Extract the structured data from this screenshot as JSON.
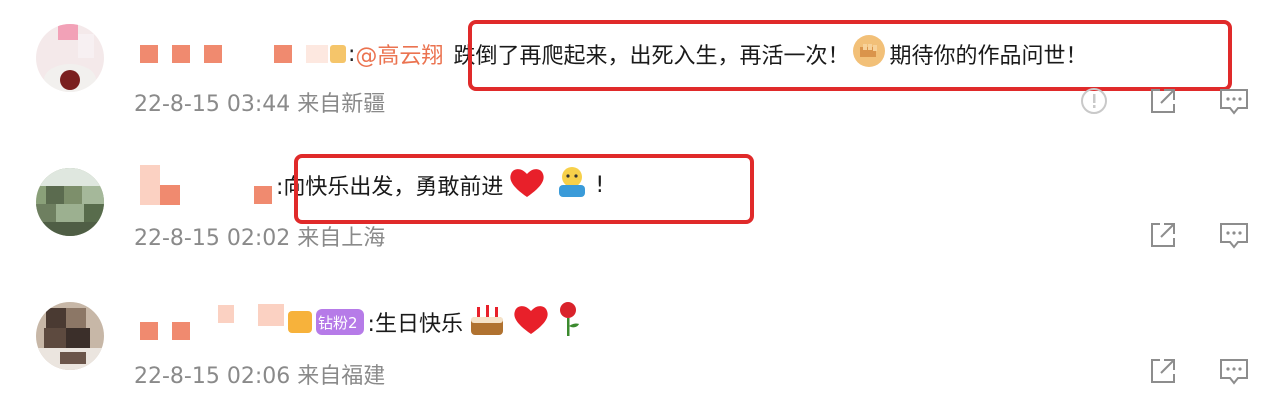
{
  "comments": [
    {
      "mention": "@高云翔",
      "text": "跌倒了再爬起来，出死入生，再活一次！",
      "text2": "期待你的作品问世！",
      "emoji": "fist-emoji",
      "meta": "22-8-15 03:44 来自新疆",
      "actions": [
        "report-icon",
        "share-icon",
        "comment-icon"
      ]
    },
    {
      "text": ":向快乐出发，勇敢前进",
      "text_end": "!",
      "emoji": [
        "heart-emoji",
        "hug-emoji"
      ],
      "meta": "22-8-15 02:02 来自上海",
      "actions": [
        "share-icon",
        "comment-icon"
      ]
    },
    {
      "badge": "钻粉2",
      "text": ":生日快乐",
      "emoji": [
        "cake-emoji",
        "heart-emoji",
        "rose-emoji"
      ],
      "meta": "22-8-15 02:06 来自福建",
      "actions": [
        "share-icon",
        "comment-icon"
      ]
    }
  ],
  "colors": {
    "accent": "#eb7350",
    "highlight": "#e02a2a",
    "meta": "#8a8a8a"
  }
}
